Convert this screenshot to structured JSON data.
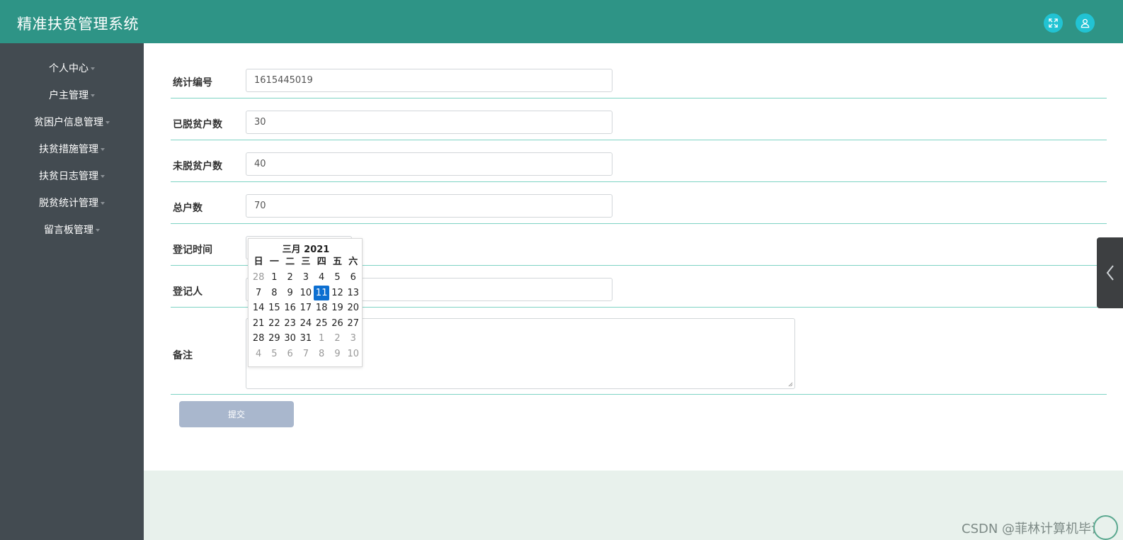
{
  "app": {
    "title": "精准扶贫管理系统"
  },
  "header": {
    "icons": [
      "fullscreen-icon",
      "user-icon"
    ]
  },
  "sidebar": {
    "items": [
      {
        "label": "个人中心"
      },
      {
        "label": "户主管理"
      },
      {
        "label": "贫困户信息管理"
      },
      {
        "label": "扶贫措施管理"
      },
      {
        "label": "扶贫日志管理"
      },
      {
        "label": "脱贫统计管理"
      },
      {
        "label": "留言板管理"
      }
    ]
  },
  "form": {
    "fields": [
      {
        "label": "统计编号",
        "value": "1615445019"
      },
      {
        "label": "已脱贫户数",
        "value": "30"
      },
      {
        "label": "未脱贫户数",
        "value": "40"
      },
      {
        "label": "总户数",
        "value": "70"
      },
      {
        "label": "登记时间",
        "value": ""
      },
      {
        "label": "登记人",
        "value": ""
      }
    ],
    "remark_label": "备注",
    "submit_label": "提交"
  },
  "datepicker": {
    "title": "三月 2021",
    "weekdays": [
      "日",
      "一",
      "二",
      "三",
      "四",
      "五",
      "六"
    ],
    "weeks": [
      [
        "28",
        "1",
        "2",
        "3",
        "4",
        "5",
        "6"
      ],
      [
        "7",
        "8",
        "9",
        "10",
        "11",
        "12",
        "13"
      ],
      [
        "14",
        "15",
        "16",
        "17",
        "18",
        "19",
        "20"
      ],
      [
        "21",
        "22",
        "23",
        "24",
        "25",
        "26",
        "27"
      ],
      [
        "28",
        "29",
        "30",
        "31",
        "1",
        "2",
        "3"
      ],
      [
        "4",
        "5",
        "6",
        "7",
        "8",
        "9",
        "10"
      ]
    ],
    "selected_day": "11",
    "selected_color": "#0d6fd1"
  },
  "watermark": {
    "text": "CSDN @菲林计算机毕设"
  },
  "colors": {
    "header": "#2e9486",
    "sidebar": "#434b51",
    "accent": "#22c3d3",
    "divider": "#7ed3c4",
    "submit": "#a9b7cd"
  }
}
